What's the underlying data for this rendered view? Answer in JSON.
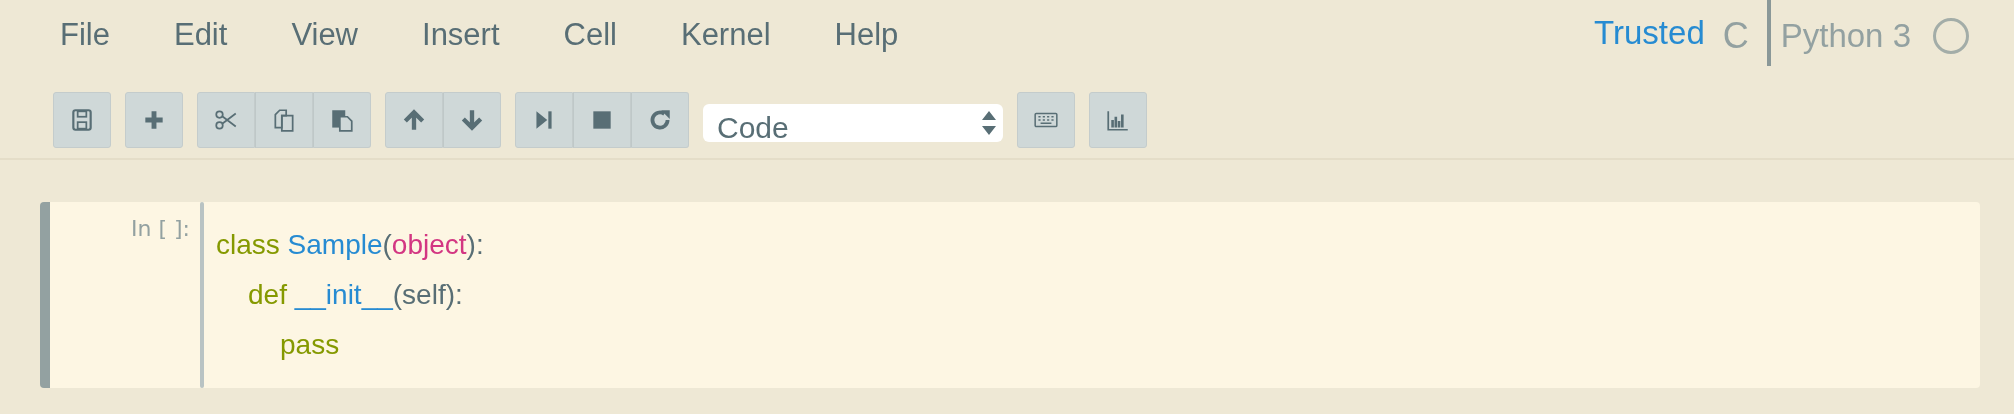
{
  "menu": [
    "File",
    "Edit",
    "View",
    "Insert",
    "Cell",
    "Kernel",
    "Help"
  ],
  "indicators": {
    "trusted": "Trusted",
    "mode": "C",
    "kernel_name": "Python 3",
    "kernel_busy": false
  },
  "toolbar": {
    "cell_type": "Code"
  },
  "cell": {
    "selected": true,
    "prompt": "In [ ]:",
    "lines": [
      {
        "tokens": [
          {
            "text": "class ",
            "kind": "keyword"
          },
          {
            "text": "Sample",
            "kind": "def"
          },
          {
            "text": "(",
            "kind": "punct"
          },
          {
            "text": "object",
            "kind": "builtin"
          },
          {
            "text": "):",
            "kind": "punct"
          }
        ],
        "children": [
          {
            "tokens": [
              {
                "text": "def ",
                "kind": "keyword"
              },
              {
                "text": "__init__",
                "kind": "def"
              },
              {
                "text": "(self):",
                "kind": "punct"
              }
            ],
            "children": [
              {
                "tokens": [
                  {
                    "text": "pass",
                    "kind": "keyword"
                  }
                ]
              }
            ]
          }
        ]
      }
    ]
  }
}
